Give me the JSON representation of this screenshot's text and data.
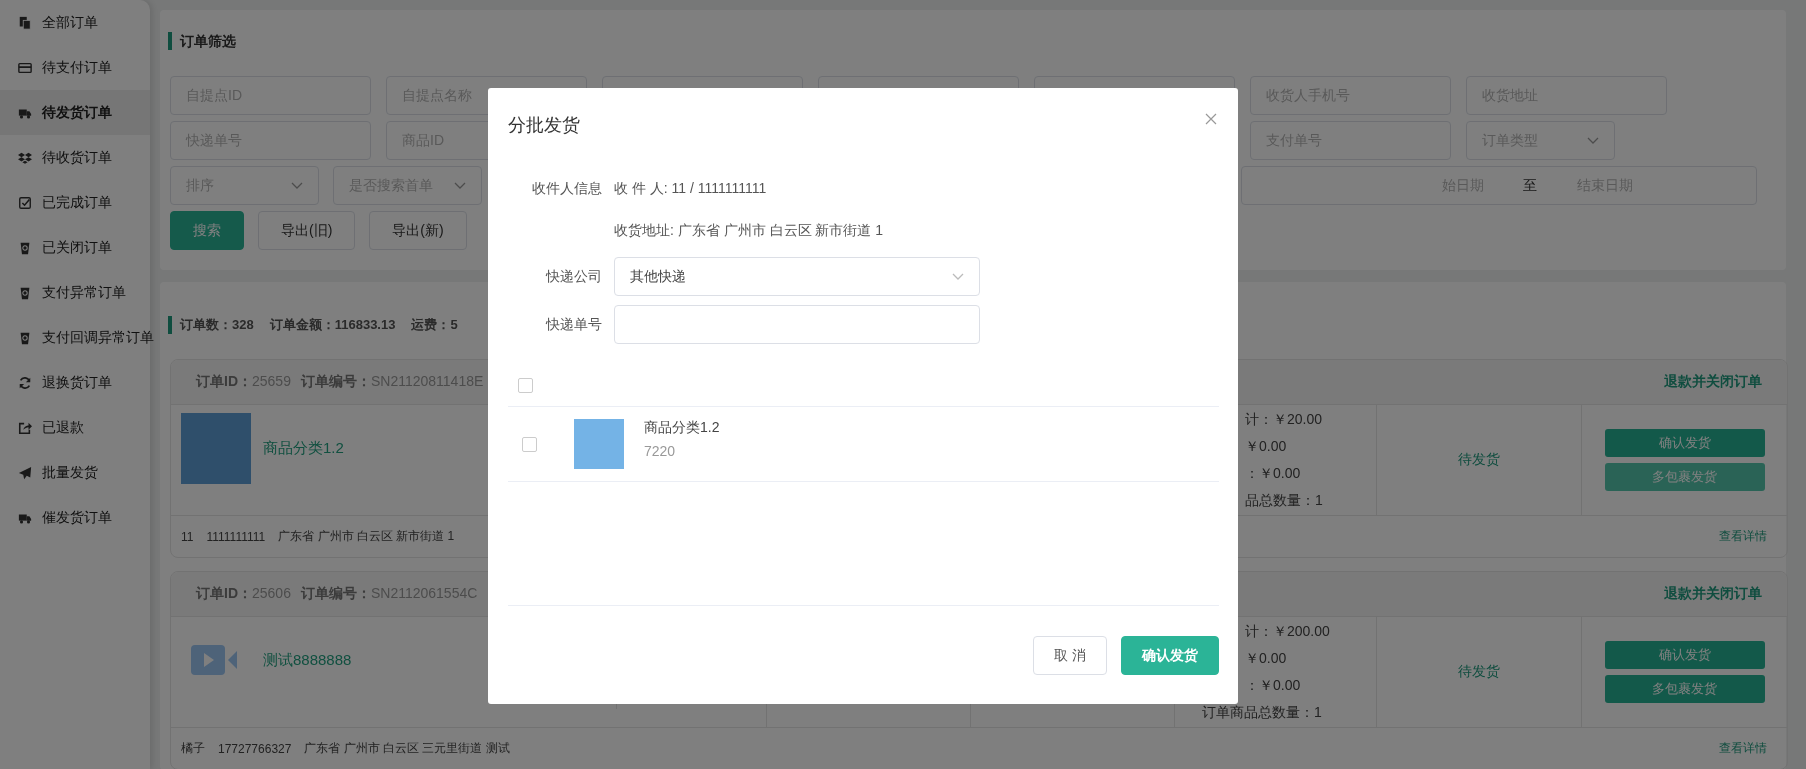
{
  "sidebar": {
    "items": [
      {
        "label": "全部订单",
        "selected": false
      },
      {
        "label": "待支付订单",
        "selected": false
      },
      {
        "label": "待发货订单",
        "selected": true
      },
      {
        "label": "待收货订单",
        "selected": false
      },
      {
        "label": "已完成订单",
        "selected": false
      },
      {
        "label": "已关闭订单",
        "selected": false
      },
      {
        "label": "支付异常订单",
        "selected": false
      },
      {
        "label": "支付回调异常订单",
        "selected": false
      },
      {
        "label": "退换货订单",
        "selected": false
      },
      {
        "label": "已退款",
        "selected": false
      },
      {
        "label": "批量发货",
        "selected": false
      },
      {
        "label": "催发货订单",
        "selected": false
      }
    ]
  },
  "filter": {
    "title": "订单筛选",
    "row_1": [
      {
        "kind": "input",
        "placeholder": "自提点ID"
      },
      {
        "kind": "input",
        "placeholder": "自提点名称"
      },
      {
        "kind": "input"
      },
      {
        "kind": "input"
      },
      {
        "kind": "input"
      },
      {
        "kind": "input",
        "placeholder": "收货人手机号"
      },
      {
        "kind": "input",
        "placeholder": "收货地址"
      }
    ],
    "row_2": [
      {
        "kind": "input",
        "placeholder": "快递单号"
      },
      {
        "kind": "input",
        "placeholder": "商品ID"
      },
      {
        "kind": "input",
        "placeholder": "支付单号"
      },
      {
        "kind": "select",
        "placeholder": "订单类型"
      }
    ],
    "row_3": [
      {
        "kind": "select",
        "placeholder": "排序"
      },
      {
        "kind": "select",
        "placeholder": "是否搜索首单"
      },
      {
        "kind": "daterange",
        "start_placeholder": "始日期",
        "separator": "至",
        "end_placeholder": "结束日期"
      }
    ],
    "buttons": [
      {
        "label": "搜索",
        "kind": "primary"
      },
      {
        "label": "导出(旧)",
        "kind": "default"
      },
      {
        "label": "导出(新)",
        "kind": "default"
      }
    ]
  },
  "summary": [
    "订单数：328",
    "订单金额：116833.13",
    "运费：5"
  ],
  "orders": [
    {
      "id": "**订单ID：**25659",
      "number": "**订单编号：**SN21120811418E",
      "close_action": "退款并关闭订单",
      "product": {
        "kind": "photo",
        "name": "商品分类1.2"
      },
      "amounts": [
        {
          "text": "计：￥20.00",
          "clipped": true
        },
        {
          "text": "￥0.00",
          "clipped": true
        },
        {
          "text": "：￥0.00",
          "clipped": true
        },
        {
          "text": "品总数量：1",
          "clipped": true
        }
      ],
      "status": "待发货",
      "buttons": [
        {
          "label": "确认发货",
          "disabled": false
        },
        {
          "label": "多包裹发货",
          "disabled": true
        }
      ],
      "receiver": "11",
      "phone": "1111111111",
      "address": "广东省 广州市 白云区 新市街道 1",
      "detail_link": "查看详情"
    },
    {
      "id": "**订单ID：**25606",
      "number": "**订单编号：**SN2112061554C",
      "close_action": "退款并关闭订单",
      "product": {
        "kind": "video",
        "name": "测试8888888"
      },
      "amounts": [
        {
          "text": "计：￥200.00",
          "clipped": true
        },
        {
          "text": "￥0.00",
          "clipped": true
        },
        {
          "text": "：￥0.00",
          "clipped": true
        },
        {
          "text": "订单商品总数量：1",
          "clipped": false
        }
      ],
      "status": "待发货",
      "buttons": [
        {
          "label": "确认发货",
          "disabled": false
        },
        {
          "label": "多包裹发货",
          "disabled": false
        }
      ],
      "receiver": "橘子",
      "phone": "17727766327",
      "address": "广东省 广州市 白云区 三元里街道 测试",
      "detail_link": "查看详情"
    }
  ],
  "dialog": {
    "title": "分批发货",
    "recipient_label": "收件人信息",
    "recipient": "收 件 人: 11 / 1111111111",
    "address": "收货地址: 广东省 广州市 白云区 新市街道 1",
    "courier_label": "快递公司",
    "courier": "其他快递",
    "tracking_label": "快递单号",
    "select_all_checked": false,
    "items": [
      {
        "name": "商品分类1.2",
        "sku": "7220",
        "checked": false
      }
    ],
    "buttons": [
      {
        "label": "取 消",
        "kind": "default"
      },
      {
        "label": "确认发货",
        "kind": "primary"
      }
    ]
  }
}
